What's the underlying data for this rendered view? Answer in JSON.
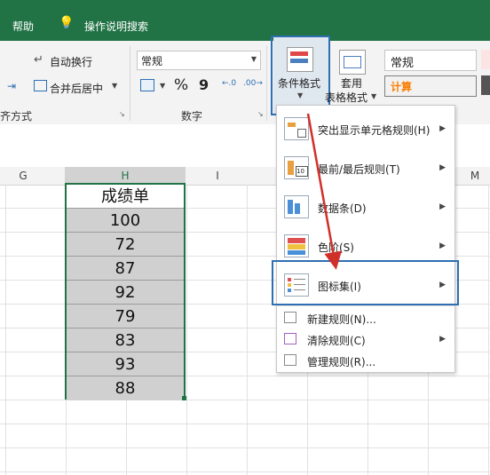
{
  "topbar": {
    "help": "帮助",
    "tell_me": "操作说明搜索"
  },
  "ribbon": {
    "wrap_text": "自动换行",
    "merge_center": "合并后居中",
    "align_group": "齐方式",
    "number_format": "常规",
    "percent": "%",
    "comma": "9",
    "number_group": "数字",
    "cond_format": "条件格式",
    "table_format_1": "套用",
    "table_format_2": "表格格式",
    "style_normal": "常规",
    "style_calc": "计算"
  },
  "columns": [
    "G",
    "H",
    "I",
    "M"
  ],
  "cells": [
    "成绩单",
    "100",
    "72",
    "87",
    "92",
    "79",
    "83",
    "93",
    "88"
  ],
  "menu": {
    "items": [
      {
        "label": "突出显示单元格规则(H)",
        "arrow": "▶"
      },
      {
        "label": "最前/最后规则(T)",
        "arrow": "▶"
      },
      {
        "label": "数据条(D)",
        "arrow": "▶"
      },
      {
        "label": "色阶(S)",
        "arrow": "▶"
      },
      {
        "label": "图标集(I)",
        "arrow": "▶"
      }
    ],
    "actions": [
      {
        "label": "新建规则(N)..."
      },
      {
        "label": "清除规则(C)",
        "arrow": "▶"
      },
      {
        "label": "管理规则(R)..."
      }
    ]
  },
  "colors": {
    "excel_green": "#217346",
    "highlight_blue": "#2e6fb2",
    "arrow_red": "#d0302a"
  }
}
